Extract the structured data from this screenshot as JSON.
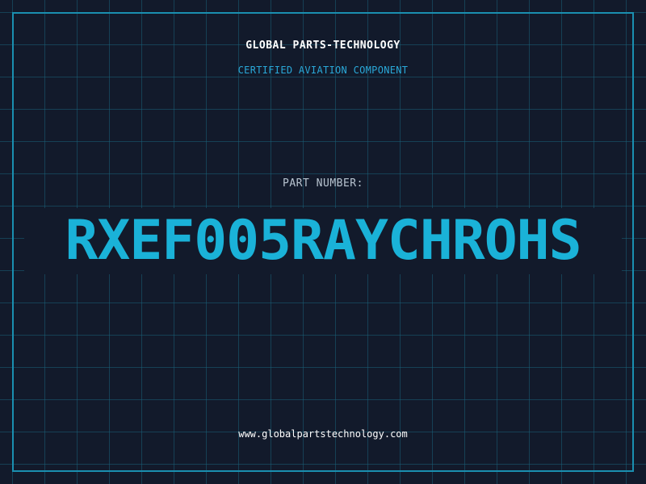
{
  "header": {
    "company": "GLOBAL PARTS-TECHNOLOGY",
    "subtitle": "CERTIFIED AVIATION COMPONENT"
  },
  "part": {
    "label": "PART NUMBER:",
    "number": "RXEF005RAYCHROHS"
  },
  "footer": {
    "url": "www.globalpartstechnology.com"
  },
  "colors": {
    "background": "#121a2b",
    "grid": "#1a5f78",
    "frame": "#1a8fb0",
    "accent": "#1ab2d8",
    "text": "#ffffff",
    "muted": "#b8c4d0"
  }
}
